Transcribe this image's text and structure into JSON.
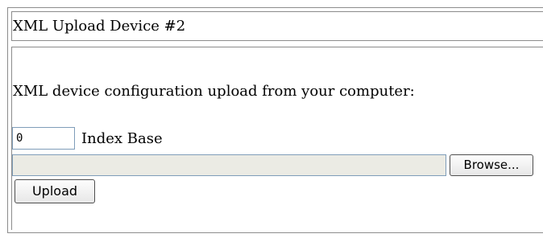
{
  "title": "XML Upload Device #2",
  "description": "XML device configuration upload from your computer:",
  "index_base": {
    "value": "0",
    "label": "Index Base"
  },
  "file_picker": {
    "path_value": "",
    "browse_label": "Browse..."
  },
  "upload_label": "Upload",
  "colors": {
    "border": "#8c8c8c",
    "input_border": "#7f9db9",
    "disabled_field": "#ebebe4",
    "button_border": "#4f4f4f"
  }
}
